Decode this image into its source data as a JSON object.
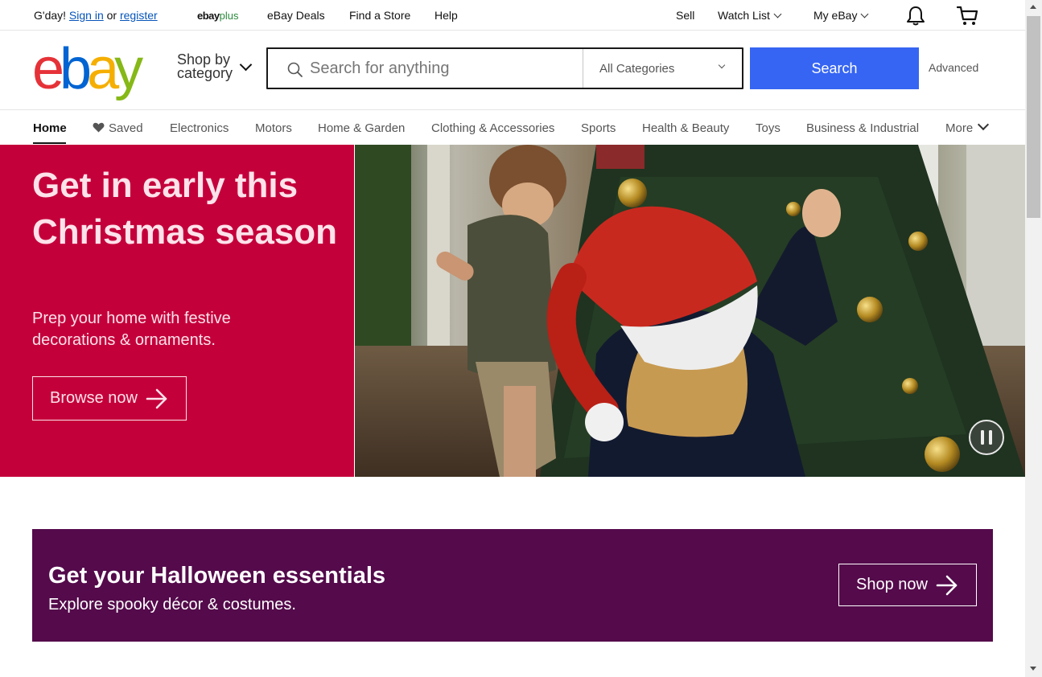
{
  "topbar": {
    "greeting": "G'day!",
    "sign_in": "Sign in",
    "or": "or",
    "register": "register",
    "ebayplus_ebay": "ebay",
    "ebayplus_plus": "plus",
    "deals": "eBay Deals",
    "find_store": "Find a Store",
    "help": "Help",
    "sell": "Sell",
    "watch_list": "Watch List",
    "my_ebay": "My eBay",
    "icons": [
      "bell-icon",
      "cart-icon"
    ]
  },
  "header": {
    "logo_letters": [
      "e",
      "b",
      "a",
      "y"
    ],
    "logo_colors": [
      "#e53238",
      "#0064d2",
      "#f5af02",
      "#86b817"
    ],
    "shop_by": "Shop by",
    "category": "category",
    "search_placeholder": "Search for anything",
    "category_select": "All Categories",
    "search_button": "Search",
    "advanced": "Advanced",
    "accent": "#3665f3"
  },
  "nav": {
    "items": [
      "Home",
      "Saved",
      "Electronics",
      "Motors",
      "Home & Garden",
      "Clothing & Accessories",
      "Sports",
      "Health & Beauty",
      "Toys",
      "Business & Industrial",
      "More"
    ],
    "active": "Home"
  },
  "hero": {
    "title": "Get in early this Christmas season",
    "subtitle": "Prep your home with festive decorations & ornaments.",
    "button": "Browse now",
    "background": "#c4003b",
    "text_color": "#fde2ea"
  },
  "promo": {
    "title": "Get your Halloween essentials",
    "subtitle": "Explore spooky décor & costumes.",
    "button": "Shop now",
    "background": "#540a4b"
  }
}
